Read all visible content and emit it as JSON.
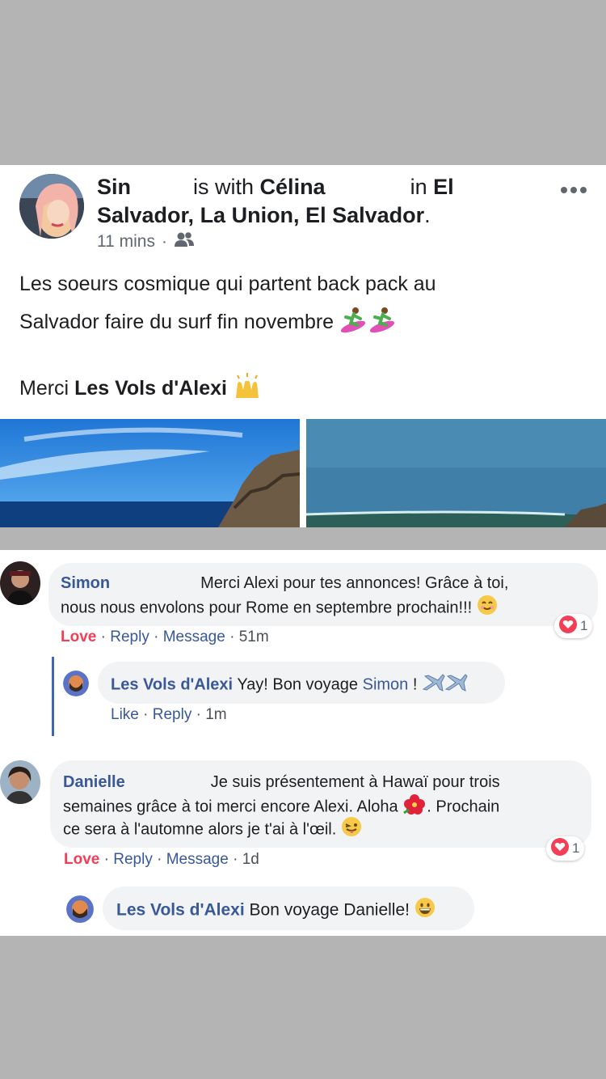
{
  "post": {
    "author": "Sin",
    "with_text": "is with",
    "tagged": "Célina",
    "in_text": "in",
    "location_part1": "El",
    "location_part2": "Salvador, La Union, El Salvador",
    "period": ".",
    "time": "11 mins",
    "dot": "·",
    "privacy_icon": "friends-icon",
    "more_icon": "more-options-icon",
    "text_line1": "Les soeurs cosmique qui partent back pack au",
    "text_line2": "Salvador faire du surf fin novembre",
    "text_line3_prefix": "Merci",
    "text_line3_page": "Les Vols d'Alexi"
  },
  "comments": [
    {
      "name": "Simon",
      "line1": "Merci Alexi pour tes annonces! Grâce à toi,",
      "line2": "nous nous envolons pour Rome en septembre prochain!!!",
      "actions": {
        "love": "Love",
        "reply": "Reply",
        "message": "Message",
        "time": "51m"
      },
      "reaction_count": "1",
      "reply": {
        "name": "Les Vols d'Alexi",
        "text": "Yay! Bon voyage",
        "mention": "Simon",
        "suffix": "!",
        "actions": {
          "like": "Like",
          "reply": "Reply",
          "time": "1m"
        }
      }
    },
    {
      "name": "Danielle",
      "line1": "Je suis présentement à Hawaï pour trois",
      "line2a": "semaines grâce à toi merci encore Alexi. Aloha",
      "line2b": ". Prochain",
      "line3": "ce sera à l'automne alors je t'ai à l'œil.",
      "actions": {
        "love": "Love",
        "reply": "Reply",
        "message": "Message",
        "time": "1d"
      },
      "reaction_count": "1",
      "reply": {
        "name": "Les Vols d'Alexi",
        "text": "Bon voyage Danielle!"
      }
    }
  ],
  "colors": {
    "link": "#385898",
    "love": "#f33e58",
    "bubble": "#f2f3f5",
    "thread": "#4267b2"
  }
}
